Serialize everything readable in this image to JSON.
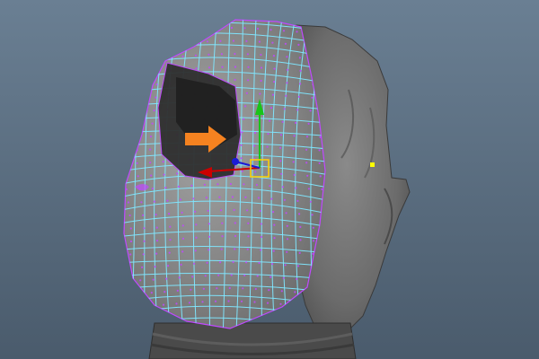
{
  "viewport": {
    "background_top": "#6a7f93",
    "background_bottom": "#4a5b6c"
  },
  "scene": {
    "mesh_gray": "#6b6b6b",
    "mesh_gray_light": "#8a8a8a",
    "mesh_gray_dark": "#444444",
    "wireframe_cyan": "#7fe7ff",
    "wireframe_magenta": "#c048ff"
  },
  "manipulator": {
    "x_axis_color": "#cc0000",
    "y_axis_color": "#19c419",
    "z_axis_color": "#1b1bd6",
    "center_color": "#ffd400",
    "selected_handle_color": "#ffff00"
  },
  "annotation": {
    "arrow_color": "#f58220",
    "arrow_icon": "orange-arrow-icon"
  }
}
